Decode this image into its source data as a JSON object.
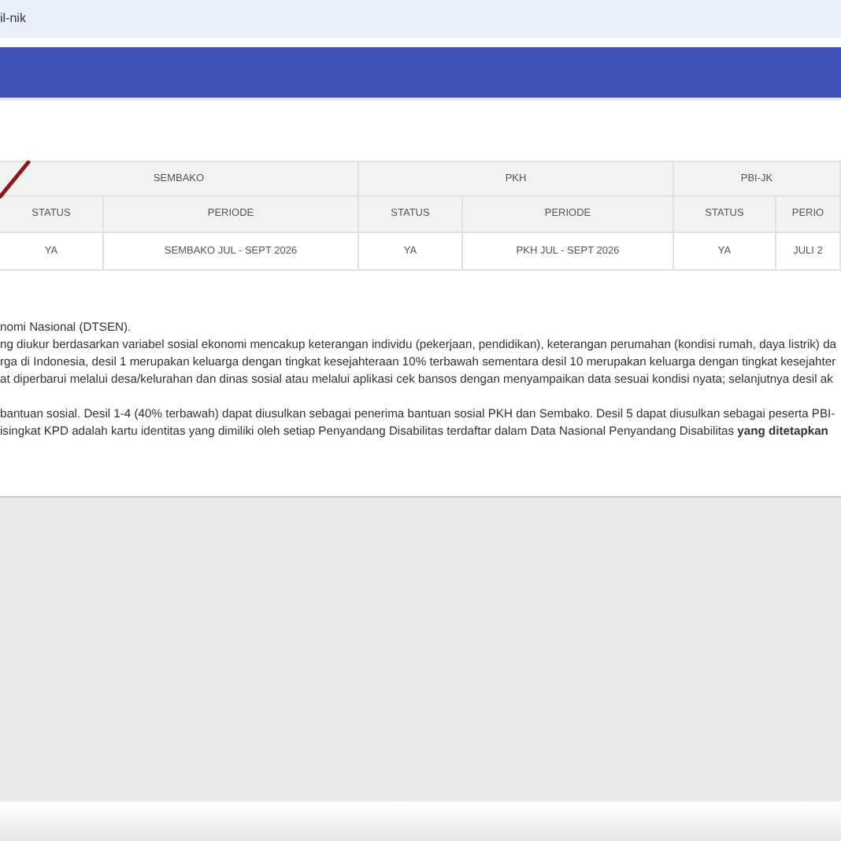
{
  "address_bar": {
    "url": "il-nik"
  },
  "table": {
    "groups": [
      "SEMBAKO",
      "PKH",
      "PBI-JK"
    ],
    "columns": [
      "STATUS",
      "PERIODE",
      "STATUS",
      "PERIODE",
      "STATUS",
      "PERIO"
    ],
    "rows": [
      [
        "YA",
        "SEMBAKO JUL - SEPT 2026",
        "YA",
        "PKH JUL - SEPT 2026",
        "YA",
        "JULI 2"
      ]
    ]
  },
  "notes": [
    {
      "text": "nomi Nasional (DTSEN)."
    },
    {
      "text": "ng diukur berdasarkan variabel sosial ekonomi mencakup keterangan individu (pekerjaan, pendidikan), keterangan perumahan (kondisi rumah, daya listrik) da"
    },
    {
      "text": "rga di Indonesia, desil 1 merupakan keluarga dengan tingkat kesejahteraan 10% terbawah sementara desil 10 merupakan keluarga dengan tingkat kesejahter"
    },
    {
      "text": "at diperbarui melalui desa/kelurahan dan dinas sosial atau melalui aplikasi cek bansos dengan menyampaikan data sesuai kondisi nyata; selanjutnya desil ak"
    },
    {
      "text": "bantuan sosial. Desil 1-4 (40% terbawah) dapat diusulkan sebagai penerima bantuan sosial PKH dan Sembako. Desil 5 dapat diusulkan sebagai peserta PBI-"
    },
    {
      "text": "isingkat KPD adalah kartu identitas yang dimiliki oleh setiap Penyandang Disabilitas terdaftar dalam Data Nasional Penyandang Disabilitas **yang ditetapkan**"
    }
  ]
}
